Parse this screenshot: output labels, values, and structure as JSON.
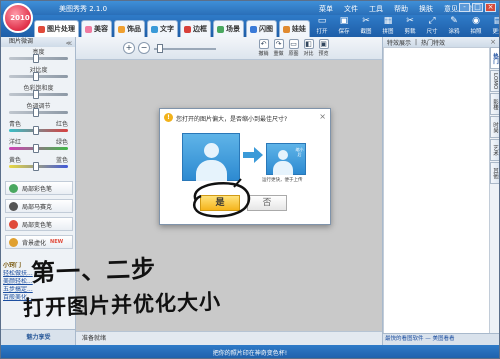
{
  "app": {
    "logo_text": "2010",
    "title": "美图秀秀 2.1.0",
    "menu": [
      "菜单",
      "文件",
      "工具",
      "帮助",
      "换肤",
      "意见反馈"
    ],
    "window_buttons": [
      "-",
      "□",
      "×"
    ]
  },
  "tabs": [
    {
      "label": "图片处理",
      "color": "#e04a3a"
    },
    {
      "label": "美容",
      "color": "#f07aa0"
    },
    {
      "label": "饰品",
      "color": "#f0a030"
    },
    {
      "label": "文字",
      "color": "#3a9ad8"
    },
    {
      "label": "边框",
      "color": "#d8403a"
    },
    {
      "label": "场景",
      "color": "#4aa860"
    },
    {
      "label": "闪图",
      "color": "#3a7ad8"
    },
    {
      "label": "娃娃",
      "color": "#e08a30"
    }
  ],
  "top_tools": [
    {
      "label": "打开",
      "glyph": "▭"
    },
    {
      "label": "保存",
      "glyph": "▣"
    },
    {
      "label": "截图",
      "glyph": "✂"
    },
    {
      "label": "拼图",
      "glyph": "▦"
    },
    {
      "label": "剪裁",
      "glyph": "✂"
    },
    {
      "label": "尺寸",
      "glyph": "⤢"
    },
    {
      "label": "涂鸦",
      "glyph": "✎"
    },
    {
      "label": "拍照",
      "glyph": "◉"
    },
    {
      "label": "更多",
      "glyph": "▤"
    }
  ],
  "left_panel": {
    "title": "图片微调",
    "reset": "≪",
    "sliders": [
      {
        "label": "亮度",
        "right": "",
        "level": 0.45
      },
      {
        "label": "对比度",
        "right": "",
        "level": 0.45
      },
      {
        "label": "色彩饱和度",
        "right": "",
        "level": 0.45
      },
      {
        "label": "色调调节",
        "right": "",
        "level": 0.45
      },
      {
        "label": "青色",
        "right": "红色",
        "level": 0.45
      },
      {
        "label": "洋红",
        "right": "绿色",
        "level": 0.45
      },
      {
        "label": "黄色",
        "right": "蓝色",
        "level": 0.45
      }
    ],
    "effects": [
      {
        "label": "局部彩色笔",
        "color": "#4aa860"
      },
      {
        "label": "局部马赛克",
        "color": "#555555"
      },
      {
        "label": "局部变色笔",
        "color": "#e04a3a"
      },
      {
        "label": "背景虚化",
        "color": "#e0a030",
        "badge": "NEW"
      }
    ],
    "tips": [
      "小窍门",
      "轻松做扶...",
      "美颜轻松...",
      "五步搞定...",
      "百般美化..."
    ],
    "bottom": "魅力享受"
  },
  "canvas_toolbar": {
    "zoom_in": "+",
    "zoom_out": "−",
    "zoom_level": 0.06,
    "tools": [
      {
        "label": "撤销",
        "glyph": "↶"
      },
      {
        "label": "重做",
        "glyph": "↷"
      },
      {
        "label": "原图",
        "glyph": "▭"
      },
      {
        "label": "对比",
        "glyph": "◧"
      },
      {
        "label": "预览",
        "glyph": "▣"
      }
    ]
  },
  "canvas_status": "准备就绪",
  "right_panel": {
    "tabs": [
      "特效展示",
      "热门特效"
    ],
    "close": "×",
    "vtabs": [
      "热门",
      "LOMO",
      "影楼",
      "时尚",
      "艺术",
      "其他"
    ],
    "footer": "最快的看图软件 — 美图看看"
  },
  "status_bar": "把你的照片印在神奇变色杯!",
  "dialog": {
    "message": "您打开的图片偏大，是否缩小到最佳尺寸?",
    "warn": "!",
    "close": "×",
    "small_tag": "缩小后",
    "caption": "运行更快，便于上传",
    "yes": "是",
    "no": "否"
  },
  "annotations": {
    "step": "第一、二步",
    "instruction": "打开图片并优化大小"
  }
}
